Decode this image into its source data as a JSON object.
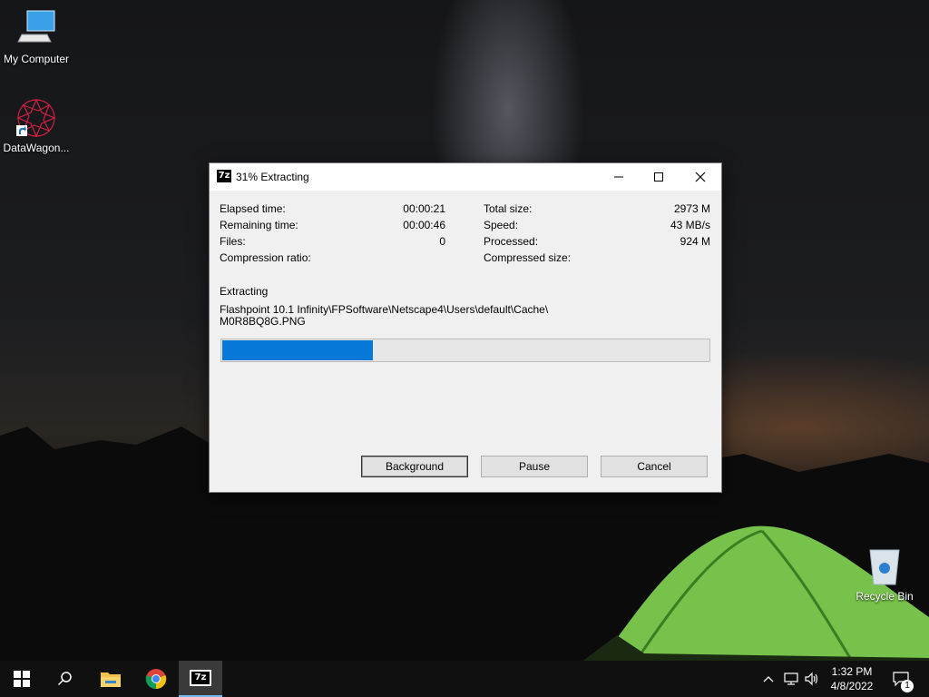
{
  "desktop": {
    "icons": [
      {
        "label": "My Computer"
      },
      {
        "label": "DataWagon..."
      },
      {
        "label": "Recycle Bin"
      }
    ]
  },
  "dialog": {
    "app_icon_text": "7z",
    "title": "31% Extracting",
    "stats_left": [
      {
        "label": "Elapsed time:",
        "value": "00:00:21"
      },
      {
        "label": "Remaining time:",
        "value": "00:00:46"
      },
      {
        "label": "Files:",
        "value": "0"
      },
      {
        "label": "Compression ratio:",
        "value": ""
      }
    ],
    "stats_right": [
      {
        "label": "Total size:",
        "value": "2973 M"
      },
      {
        "label": "Speed:",
        "value": "43 MB/s"
      },
      {
        "label": "Processed:",
        "value": "924 M"
      },
      {
        "label": "Compressed size:",
        "value": ""
      }
    ],
    "status_label": "Extracting",
    "current_path_line1": "Flashpoint 10.1 Infinity\\FPSoftware\\Netscape4\\Users\\default\\Cache\\",
    "current_path_line2": "M0R8BQ8G.PNG",
    "progress_fraction": 0.31,
    "buttons": {
      "background": "Background",
      "pause": "Pause",
      "cancel": "Cancel"
    },
    "accent_color": "#0678d7"
  },
  "taskbar": {
    "items": [
      "start",
      "search",
      "file-explorer",
      "chrome",
      "7-zip"
    ],
    "time": "1:32 PM",
    "date": "4/8/2022",
    "notification_count": "1"
  }
}
